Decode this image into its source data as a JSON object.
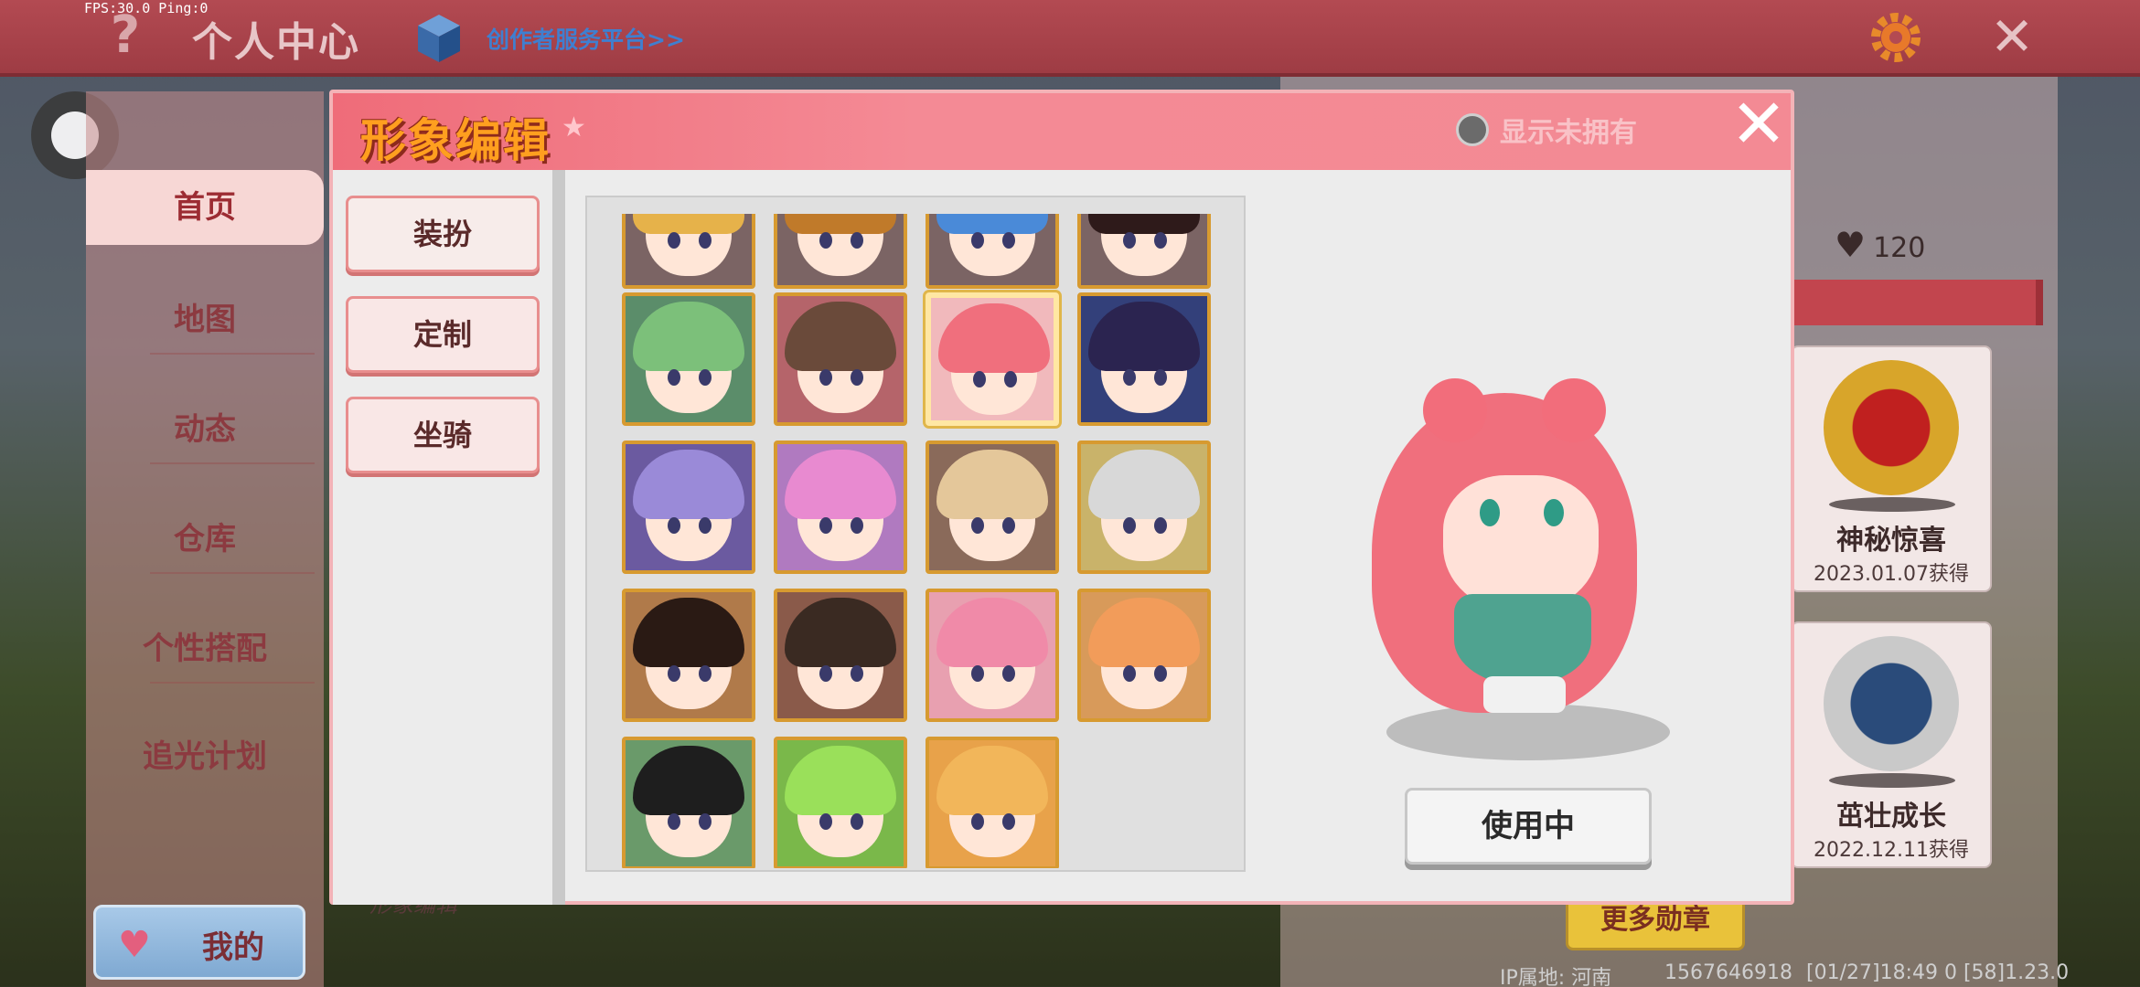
{
  "debug": {
    "fps": "FPS:30.0  Ping:0"
  },
  "header": {
    "title": "个人中心",
    "creator_link": "创作者服务平台>>",
    "help_icon": "question-mark-icon",
    "settings_icon": "gear-icon",
    "close_icon": "close-icon"
  },
  "leftnav": {
    "items": [
      {
        "label": "首页",
        "active": true
      },
      {
        "label": "地图"
      },
      {
        "label": "动态"
      },
      {
        "label": "仓库"
      },
      {
        "label": "个性搭配"
      },
      {
        "label": "追光计划"
      }
    ],
    "my_button": "我的"
  },
  "profile": {
    "likes": "120",
    "background_caption": "形象编辑",
    "medals": [
      {
        "name": "神秘惊喜",
        "date": "2023.01.07获得"
      },
      {
        "name": "茁壮成长",
        "date": "2022.12.11获得"
      }
    ],
    "more_medals": "更多勋章",
    "footer": {
      "ip": "IP属地: 河南",
      "uid": "1567646918",
      "time": "[01/27]18:49 0  [58]1.23.0"
    }
  },
  "modal": {
    "title": "形象编辑",
    "show_unowned": "显示未拥有",
    "tabs": [
      "装扮",
      "定制",
      "坐骑"
    ],
    "use_button": "使用中",
    "avatars": [
      {
        "hair": "#e6b24a",
        "bg": "#7b6464"
      },
      {
        "hair": "#c07a2a",
        "bg": "#7b6464"
      },
      {
        "hair": "#4a8ad8",
        "bg": "#7b6464"
      },
      {
        "hair": "#2e1a1a",
        "bg": "#7b6464"
      },
      {
        "hair": "#7cc07a",
        "bg": "#5b8d6a"
      },
      {
        "hair": "#6a4a3a",
        "bg": "#b5646a"
      },
      {
        "hair": "#f06f7d",
        "bg": "#f1b9bc",
        "selected": true
      },
      {
        "hair": "#2b2450",
        "bg": "#33407a"
      },
      {
        "hair": "#9a8ad8",
        "bg": "#6b5aa0"
      },
      {
        "hair": "#e88ad0",
        "bg": "#b07ac0"
      },
      {
        "hair": "#e4c79a",
        "bg": "#8a6a5a"
      },
      {
        "hair": "#d8d8d8",
        "bg": "#c9b36a"
      },
      {
        "hair": "#2a1a14",
        "bg": "#b07a4a"
      },
      {
        "hair": "#3a2a22",
        "bg": "#8a5a4a"
      },
      {
        "hair": "#f08aa8",
        "bg": "#e8a0b0"
      },
      {
        "hair": "#f29c5a",
        "bg": "#d89a5a"
      },
      {
        "hair": "#1e1e1e",
        "bg": "#6a9a6a"
      },
      {
        "hair": "#9ae05a",
        "bg": "#7ab84a"
      },
      {
        "hair": "#f2b65a",
        "bg": "#e8a24a"
      }
    ]
  },
  "colors": {
    "accent": "#ef6c79",
    "title_orange": "#ff9f1f",
    "tile_border": "#d79a30"
  }
}
